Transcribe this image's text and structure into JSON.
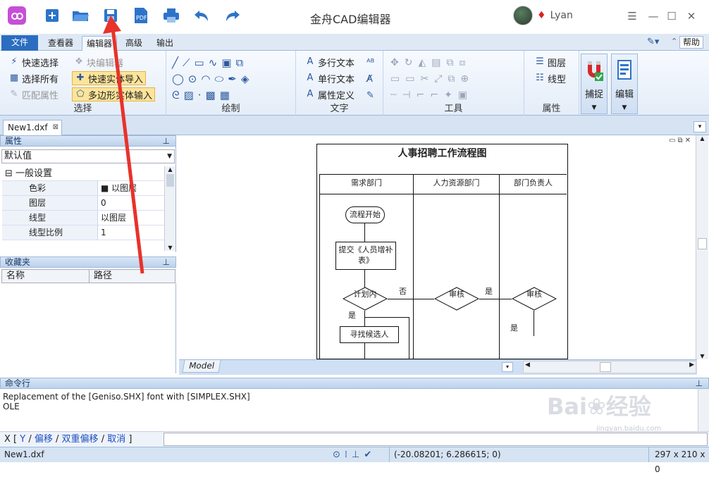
{
  "app": {
    "title": "金舟CAD编辑器",
    "user": "Lyan"
  },
  "tabs": [
    "文件",
    "查看器",
    "编辑器",
    "高级",
    "输出"
  ],
  "help": "帮助",
  "ribbon": {
    "select": {
      "label": "选择",
      "items": [
        "快速选择",
        "选择所有",
        "匹配属性",
        "块编辑器",
        "快速实体导入",
        "多边形实体输入"
      ]
    },
    "draw": {
      "label": "绘制"
    },
    "text": {
      "label": "文字",
      "items": [
        "多行文本",
        "单行文本",
        "属性定义"
      ]
    },
    "tools": {
      "label": "工具"
    },
    "props": {
      "label": "属性",
      "items": [
        "图层",
        "线型"
      ]
    },
    "snap": "捕捉",
    "edit": "编辑"
  },
  "doc_tab": "New1.dxf",
  "properties": {
    "title": "属性",
    "default": "默认值",
    "section": "一般设置",
    "rows": [
      {
        "k": "色彩",
        "v": "以图层"
      },
      {
        "k": "图层",
        "v": "0"
      },
      {
        "k": "线型",
        "v": "以图层"
      },
      {
        "k": "线型比例",
        "v": "1"
      }
    ]
  },
  "favorites": {
    "title": "收藏夹",
    "col_name": "名称",
    "col_path": "路径"
  },
  "drawing": {
    "title": "人事招聘工作流程图",
    "cols": [
      "需求部门",
      "人力资源部门",
      "部门负责人"
    ],
    "start": "流程开始",
    "submit": "提交《人员增补表》",
    "plan": "计划内",
    "no": "否",
    "yes": "是",
    "review": "审核",
    "find": "寻找候选人"
  },
  "model_tab": "Model",
  "cmd": {
    "title": "命令行",
    "lines": [
      "Replacement of the [Geniso.SHX] font with [SIMPLEX.SHX]",
      "OLE"
    ],
    "prefix": "X [",
    "options": [
      "Y",
      "偏移",
      "双重偏移",
      "取消"
    ],
    "suffix": "]"
  },
  "status": {
    "file": "New1.dxf",
    "coords": "(-20.08201; 6.286615; 0)",
    "size": "297 x 210 x 0"
  },
  "watermark": "jingyan.baidu.com"
}
